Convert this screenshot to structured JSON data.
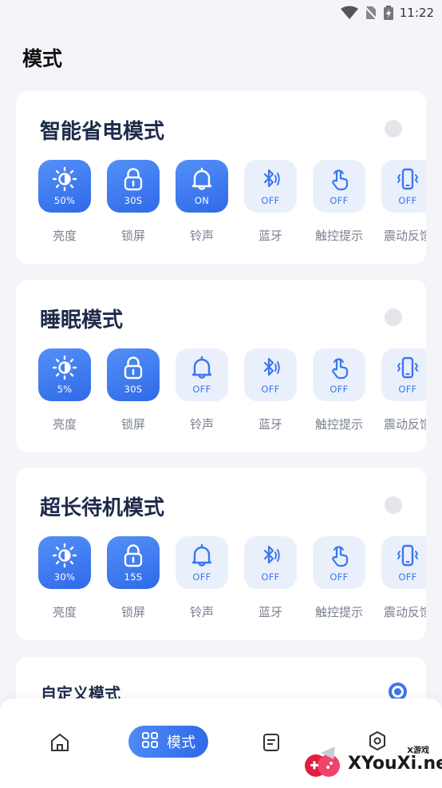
{
  "status": {
    "time": "11:22"
  },
  "page_title": "模式",
  "modes": [
    {
      "title": "智能省电模式",
      "tiles": [
        {
          "icon": "brightness-icon",
          "value": "50%",
          "label": "亮度",
          "active": true
        },
        {
          "icon": "lock-icon",
          "value": "30S",
          "label": "锁屏",
          "active": true
        },
        {
          "icon": "bell-icon",
          "value": "ON",
          "label": "铃声",
          "active": true
        },
        {
          "icon": "bluetooth-icon",
          "value": "OFF",
          "label": "蓝牙",
          "active": false
        },
        {
          "icon": "touch-icon",
          "value": "OFF",
          "label": "触控提示",
          "active": false
        },
        {
          "icon": "vibrate-icon",
          "value": "OFF",
          "label": "震动反馈",
          "active": false
        }
      ]
    },
    {
      "title": "睡眠模式",
      "tiles": [
        {
          "icon": "brightness-icon",
          "value": "5%",
          "label": "亮度",
          "active": true
        },
        {
          "icon": "lock-icon",
          "value": "30S",
          "label": "锁屏",
          "active": true
        },
        {
          "icon": "bell-icon",
          "value": "OFF",
          "label": "铃声",
          "active": false
        },
        {
          "icon": "bluetooth-icon",
          "value": "OFF",
          "label": "蓝牙",
          "active": false
        },
        {
          "icon": "touch-icon",
          "value": "OFF",
          "label": "触控提示",
          "active": false
        },
        {
          "icon": "vibrate-icon",
          "value": "OFF",
          "label": "震动反馈",
          "active": false
        }
      ]
    },
    {
      "title": "超长待机模式",
      "tiles": [
        {
          "icon": "brightness-icon",
          "value": "30%",
          "label": "亮度",
          "active": true
        },
        {
          "icon": "lock-icon",
          "value": "15S",
          "label": "锁屏",
          "active": true
        },
        {
          "icon": "bell-icon",
          "value": "OFF",
          "label": "铃声",
          "active": false
        },
        {
          "icon": "bluetooth-icon",
          "value": "OFF",
          "label": "蓝牙",
          "active": false
        },
        {
          "icon": "touch-icon",
          "value": "OFF",
          "label": "触控提示",
          "active": false
        },
        {
          "icon": "vibrate-icon",
          "value": "OFF",
          "label": "震动反馈",
          "active": false
        }
      ]
    }
  ],
  "custom_mode": {
    "title": "自定义模式",
    "selected": true
  },
  "nav": {
    "active_label": "模式"
  },
  "watermark": {
    "text": "XYouXi.net",
    "small": "X游戏"
  },
  "colors": {
    "accent": "#3c76f0",
    "tile_off_bg": "#eaf0fb",
    "page_bg": "#f3f5f9"
  }
}
